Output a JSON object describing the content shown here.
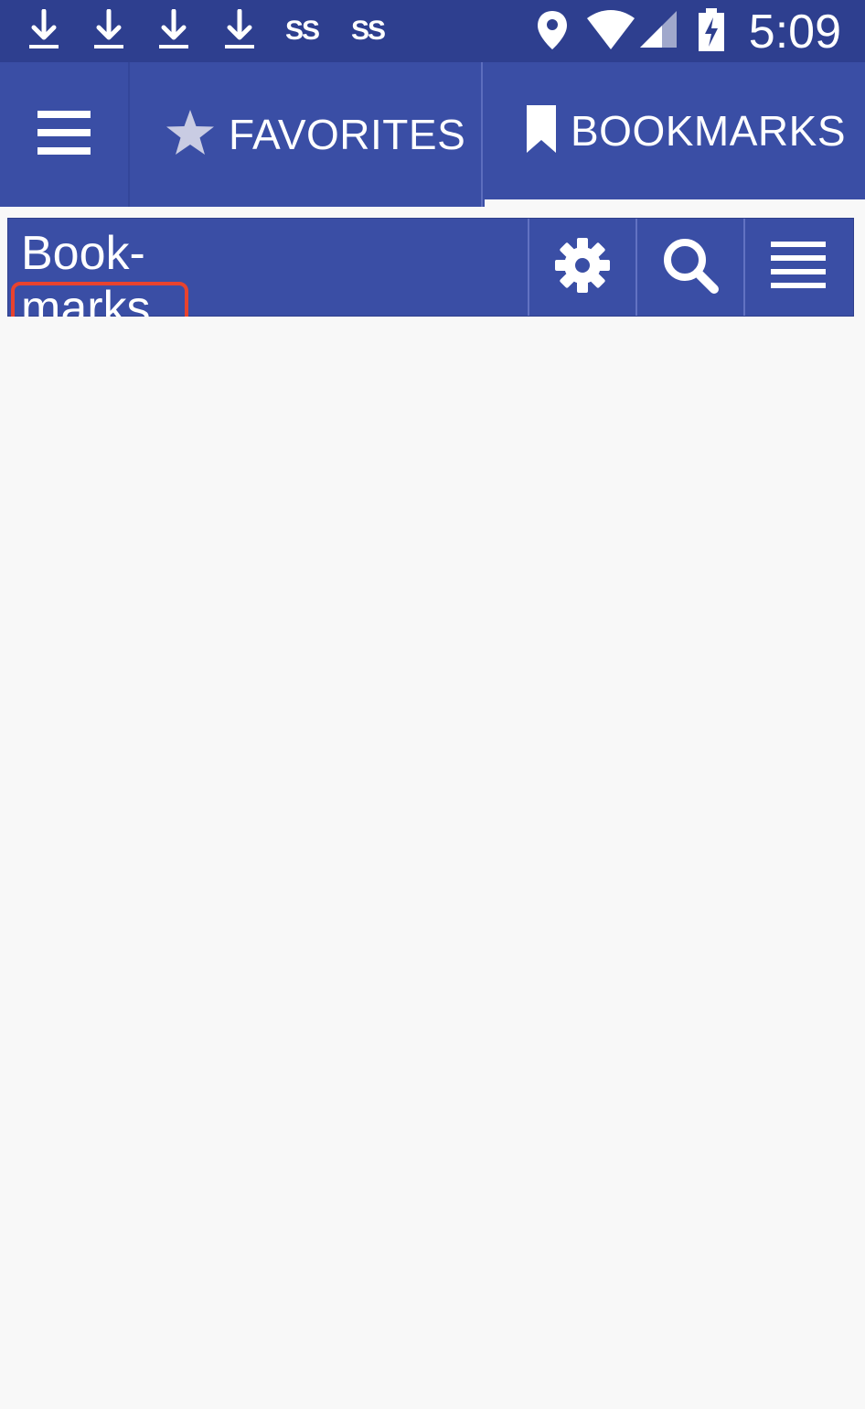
{
  "status_bar": {
    "icons": [
      "download-icon",
      "download-icon",
      "download-icon",
      "download-icon",
      "ss-icon",
      "ss-icon",
      "location-icon",
      "wifi-icon",
      "signal-icon",
      "battery-charging-icon"
    ],
    "ss_label_1": "SS",
    "ss_label_2": "SS",
    "time": "5:09"
  },
  "tabs": {
    "menu_icon": "hamburger-icon",
    "favorites": {
      "label": "FAVORITES",
      "icon": "star-icon"
    },
    "bookmarks": {
      "label": "BOOKMARKS",
      "icon": "bookmark-icon",
      "active": true
    }
  },
  "toolbar": {
    "title": "Book-\nmarks",
    "buttons": [
      "settings-gear-icon",
      "search-icon",
      "list-menu-icon"
    ]
  },
  "colors": {
    "status_bar": "#2e3f8f",
    "primary": "#3a4ea5",
    "background": "#f8f8f8",
    "highlight": "#e8432e"
  }
}
